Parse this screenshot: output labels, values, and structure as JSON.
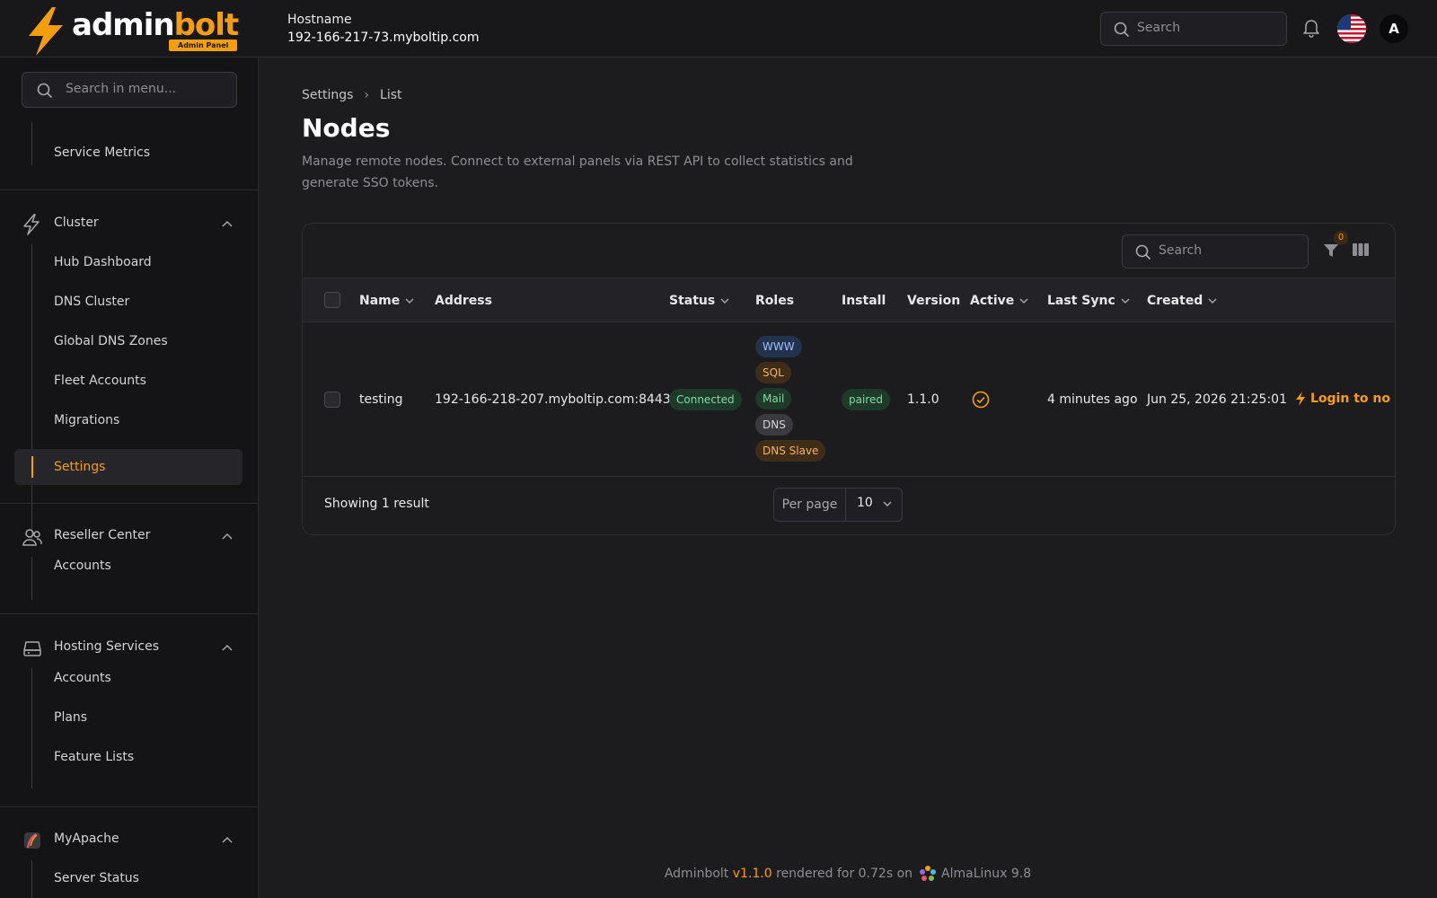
{
  "header": {
    "logo_text_white": "admin",
    "logo_text_orange": "bolt",
    "logo_badge": "Admin Panel",
    "hostname_label": "Hostname",
    "hostname_value": "192-166-217-73.myboltip.com",
    "search_placeholder": "Search",
    "avatar_initial": "A"
  },
  "sidebar": {
    "search_placeholder": "Search in menu...",
    "top_item": "Service Metrics",
    "groups": [
      {
        "label": "Cluster",
        "icon": "bolt-icon",
        "items": [
          "Hub Dashboard",
          "DNS Cluster",
          "Global DNS Zones",
          "Fleet Accounts",
          "Migrations",
          "Settings"
        ],
        "active": "Settings"
      },
      {
        "label": "Reseller Center",
        "icon": "users-icon",
        "items": [
          "Accounts"
        ]
      },
      {
        "label": "Hosting Services",
        "icon": "server-icon",
        "items": [
          "Accounts",
          "Plans",
          "Feature Lists"
        ]
      },
      {
        "label": "MyApache",
        "icon": "apache-feather-icon",
        "items": [
          "Server Status"
        ]
      }
    ]
  },
  "main": {
    "breadcrumb": [
      "Settings",
      "List"
    ],
    "title": "Nodes",
    "description": "Manage remote nodes. Connect to external panels via REST API to collect statistics and generate SSO tokens.",
    "table": {
      "search_placeholder": "Search",
      "filter_count": "0",
      "columns": [
        "Name",
        "Address",
        "Status",
        "Roles",
        "Install",
        "Version",
        "Active",
        "Last Sync",
        "Created"
      ],
      "rows": [
        {
          "name": "testing",
          "address": "192-166-218-207.myboltip.com:8443",
          "status": "Connected",
          "roles": [
            "WWW",
            "SQL",
            "Mail",
            "DNS",
            "DNS Slave"
          ],
          "install": "paired",
          "version": "1.1.0",
          "active": true,
          "last_sync": "4 minutes ago",
          "created": "Jun 25, 2026 21:25:01",
          "action": "Login to no"
        }
      ],
      "showing": "Showing 1 result",
      "per_page_label": "Per page",
      "per_page_value": "10"
    }
  },
  "footer": {
    "brand": "Adminbolt",
    "version": "v1.1.0",
    "rendered": "rendered for 0.72s on",
    "os": "AlmaLinux 9.8"
  },
  "colors": {
    "accent": "#f59e0b",
    "background": "#1c1c1f",
    "sidebar": "#141416"
  }
}
